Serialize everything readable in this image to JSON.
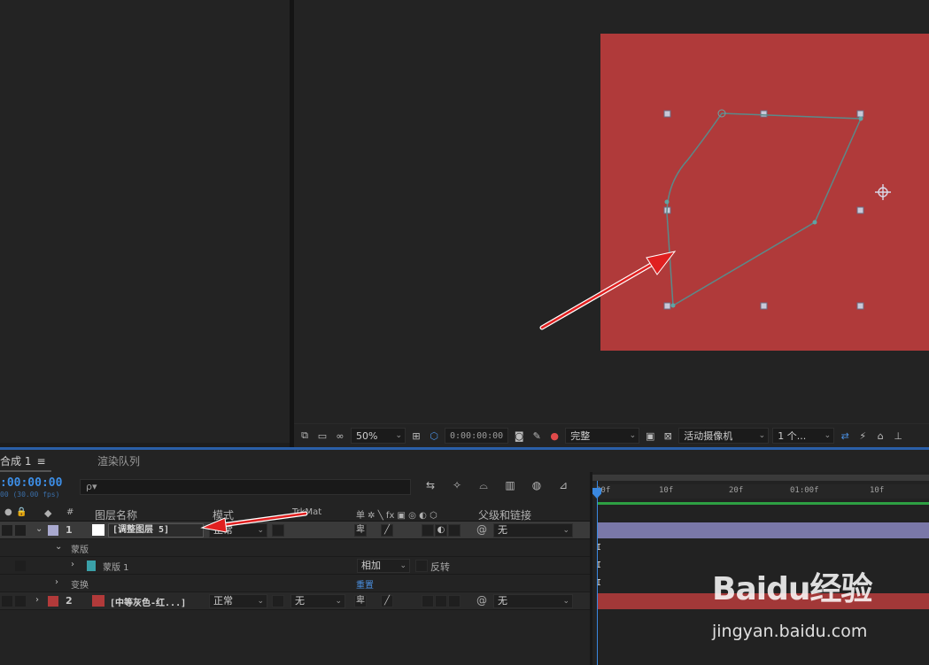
{
  "viewer": {
    "zoom": "50%",
    "time": "0:00:00:00",
    "resolution": "完整",
    "camera": "活动摄像机",
    "views": "1 个..."
  },
  "timeline": {
    "tabs": [
      {
        "label": "合成 1",
        "menu": "≡"
      },
      {
        "label": "渲染队列"
      }
    ],
    "timecode": ":00:00:00",
    "fps": "00 (30.00 fps)",
    "search_placeholder": "ρ▾",
    "columns": {
      "num": "#",
      "layer_name": "图层名称",
      "mode": "模式",
      "trkmat": "TrkMat",
      "switches": "单 ✲ ╲ fx ▣ ◎ ◐ ⬡",
      "parent": "父级和链接"
    },
    "layers": [
      {
        "index": "1",
        "name": "[调整图层 5]",
        "mode": "正常",
        "parent": "无",
        "label_color": "#a9a9cf",
        "chip_color": "#ffffff"
      },
      {
        "index": "2",
        "name": "[中等灰色-红...]",
        "mode": "正常",
        "trkmat": "无",
        "parent": "无",
        "label_color": "#b23a3a",
        "chip_color": "#b23a3a"
      }
    ],
    "mask_group": "蒙版",
    "mask": {
      "name": "蒙版 1",
      "mode": "相加",
      "invert": "反转",
      "color": "#3aa0a8"
    },
    "transform": {
      "label": "变换",
      "reset": "重置"
    },
    "ruler": [
      "00f",
      "10f",
      "20f",
      "01:00f",
      "10f"
    ]
  },
  "watermark": {
    "logo": "Baidu经验",
    "url": "jingyan.baidu.com"
  },
  "colors": {
    "comp_bg": "#b03a3a",
    "mask_path": "#5a8a8a",
    "accent": "#3a88e0",
    "arrow": "#e02020"
  }
}
